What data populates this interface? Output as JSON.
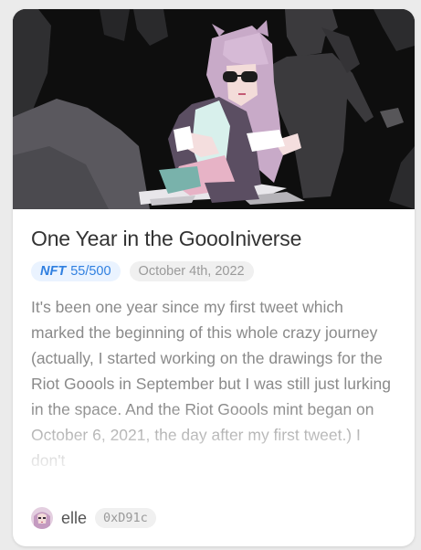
{
  "post": {
    "title": "One Year in the GoooIniverse",
    "nft_tag": "NFT",
    "nft_progress": "55/500",
    "date": "October 4th, 2022",
    "excerpt": "It's been one year since my first tweet which marked the beginning of this whole crazy journey (actually, I started working on the drawings for the Riot Goools in September but I was still just lurking in the space. And the Riot Goools mint began on October 6, 2021, the day after my first tweet.) I don't",
    "author": {
      "name": "elle",
      "address": "0xD91c",
      "avatar_icon": "anime-girl-avatar-icon"
    },
    "cover_icon": "pixel-art-anime-girl-illustration"
  },
  "colors": {
    "card_background": "#ffffff",
    "page_background": "#ebebeb",
    "nft_pill_background": "#eaf3ff",
    "nft_pill_text": "#2f7fe0",
    "date_pill_background": "#f0f0f0",
    "title_text": "#333333",
    "body_text": "#8a8a8a"
  }
}
